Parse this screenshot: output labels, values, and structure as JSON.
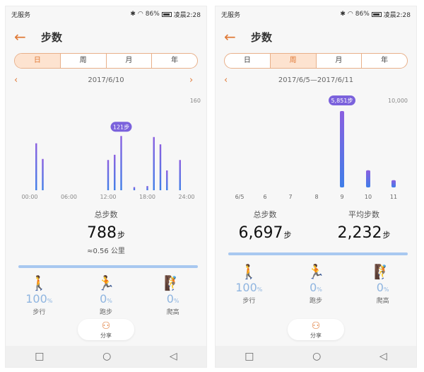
{
  "left": {
    "status": {
      "carrier": "无服务",
      "battery": "86%",
      "time": "凌晨2:28"
    },
    "header": {
      "title": "步数"
    },
    "tabs": [
      {
        "label": "日",
        "active": true
      },
      {
        "label": "周",
        "active": false
      },
      {
        "label": "月",
        "active": false
      },
      {
        "label": "年",
        "active": false
      }
    ],
    "date": "2017/6/10",
    "summary": {
      "label": "总步数",
      "value": "788",
      "unit": "步",
      "distance": "≈0.56 公里"
    },
    "activities": [
      {
        "icon": "walk-icon",
        "glyph": "🚶",
        "pct": "100",
        "label": "步行"
      },
      {
        "icon": "run-icon",
        "glyph": "🏃",
        "pct": "0",
        "label": "跑步"
      },
      {
        "icon": "climb-icon",
        "glyph": "🧗",
        "pct": "0",
        "label": "爬高"
      }
    ],
    "share_label": "分享",
    "accent": "#e07b39",
    "bar_color": "#7a6fe0"
  },
  "right": {
    "status": {
      "carrier": "无服务",
      "battery": "86%",
      "time": "凌晨2:28"
    },
    "header": {
      "title": "步数"
    },
    "tabs": [
      {
        "label": "日",
        "active": false
      },
      {
        "label": "周",
        "active": true
      },
      {
        "label": "月",
        "active": false
      },
      {
        "label": "年",
        "active": false
      }
    ],
    "date": "2017/6/5—2017/6/11",
    "summary_total": {
      "label": "总步数",
      "value": "6,697",
      "unit": "步"
    },
    "summary_avg": {
      "label": "平均步数",
      "value": "2,232",
      "unit": "步"
    },
    "activities": [
      {
        "icon": "walk-icon",
        "glyph": "🚶",
        "pct": "100",
        "label": "步行"
      },
      {
        "icon": "run-icon",
        "glyph": "🏃",
        "pct": "0",
        "label": "跑步"
      },
      {
        "icon": "climb-icon",
        "glyph": "🧗",
        "pct": "0",
        "label": "爬高"
      }
    ],
    "share_label": "分享"
  },
  "chart_data": [
    {
      "type": "bar",
      "ymax_label": "160",
      "ylim": [
        0,
        160
      ],
      "x_tick_labels": [
        "00:00",
        "06:00",
        "12:00",
        "18:00",
        "24:00"
      ],
      "tooltip": "121步",
      "bars": [
        {
          "hour": 1,
          "value": 90
        },
        {
          "hour": 2,
          "value": 60
        },
        {
          "hour": 12,
          "value": 58
        },
        {
          "hour": 13,
          "value": 68
        },
        {
          "hour": 14,
          "value": 104
        },
        {
          "hour": 16,
          "value": 6
        },
        {
          "hour": 18,
          "value": 8
        },
        {
          "hour": 19,
          "value": 102
        },
        {
          "hour": 20,
          "value": 88
        },
        {
          "hour": 21,
          "value": 38
        },
        {
          "hour": 23,
          "value": 58
        }
      ]
    },
    {
      "type": "bar",
      "ymax_label": "10,000",
      "ylim": [
        0,
        10000
      ],
      "categories": [
        "6/5",
        "6",
        "7",
        "8",
        "9",
        "10",
        "11"
      ],
      "values": [
        0,
        0,
        0,
        0,
        5851,
        1180,
        500
      ],
      "tooltip": "5,851步"
    }
  ]
}
